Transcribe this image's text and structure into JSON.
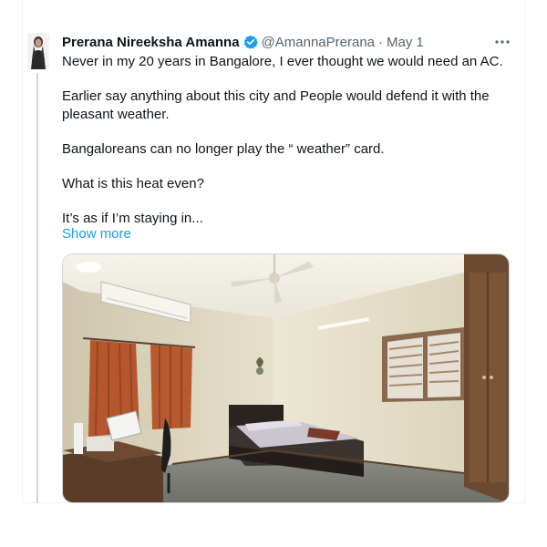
{
  "tweet": {
    "author_name": "Prerana Nireeksha Amanna",
    "handle": "@AmannaPrerana",
    "separator": "·",
    "date": "May 1",
    "verified": true,
    "paragraphs": [
      "Never in my 20 years in Bangalore, I ever thought we would need an AC.",
      "Earlier say  anything about this city and  People would defend it with the pleasant weather.",
      "Bangaloreans can no longer play the “ weather” card.",
      "What is this heat even?",
      "It’s as if I’m staying in..."
    ],
    "show_more_label": "Show more",
    "more_icon": "more-horizontal-icon"
  },
  "colors": {
    "accent": "#1d9bf0",
    "text_primary": "#0f1419",
    "text_secondary": "#536471",
    "border": "#cfd9de"
  }
}
